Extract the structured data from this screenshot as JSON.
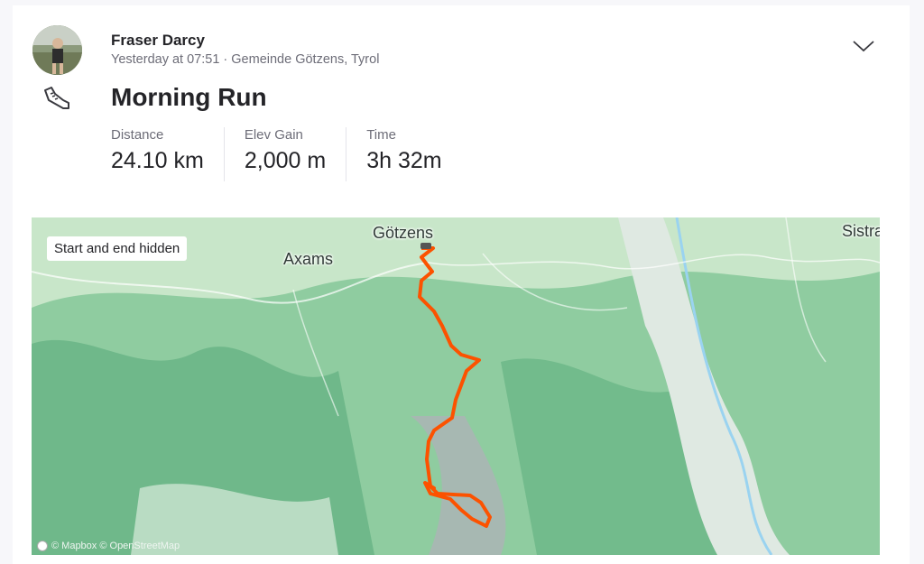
{
  "athlete": {
    "name": "Fraser Darcy",
    "meta": "Yesterday at 07:51 · Gemeinde Götzens, Tyrol"
  },
  "activity": {
    "title": "Morning Run",
    "stats": [
      {
        "label": "Distance",
        "value": "24.10 km"
      },
      {
        "label": "Elev Gain",
        "value": "2,000 m"
      },
      {
        "label": "Time",
        "value": "3h 32m"
      }
    ]
  },
  "map": {
    "badge": "Start and end hidden",
    "places": {
      "gotzens": "Götzens",
      "axams": "Axams",
      "sistrans": "Sistra"
    },
    "attribution": "© Mapbox © OpenStreetMap",
    "route_color": "#fc5200"
  },
  "icons": {
    "activity": "shoe-icon",
    "menu": "chevron-down-icon",
    "attribution": "mapbox-logo-icon"
  }
}
